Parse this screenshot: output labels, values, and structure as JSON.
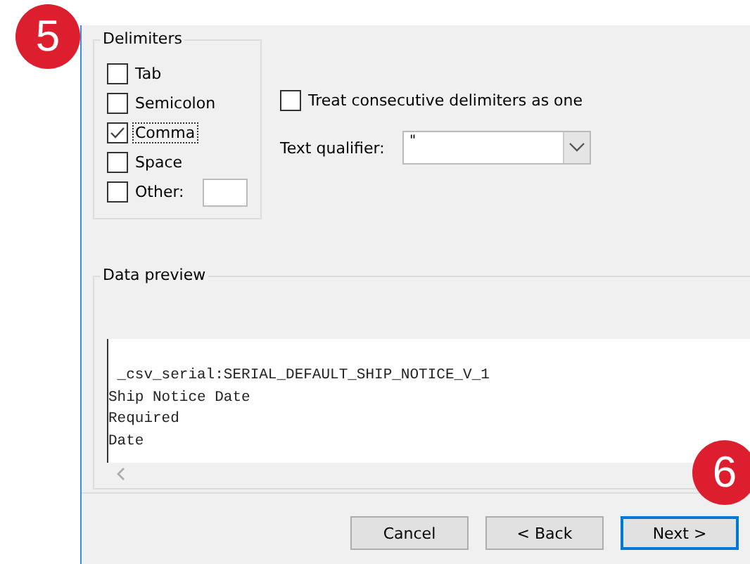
{
  "badges": [
    {
      "label": "5"
    },
    {
      "label": "6"
    }
  ],
  "delimiters": {
    "title": "Delimiters",
    "options": [
      {
        "label": "Tab",
        "checked": false,
        "focused": false
      },
      {
        "label": "Semicolon",
        "checked": false,
        "focused": false
      },
      {
        "label": "Comma",
        "checked": true,
        "focused": true
      },
      {
        "label": "Space",
        "checked": false,
        "focused": false
      },
      {
        "label": "Other:",
        "checked": false,
        "focused": false,
        "kind": "with_field"
      }
    ]
  },
  "consecutive": {
    "label": "Treat consecutive delimiters as one",
    "checked": false
  },
  "qualifier": {
    "label": "Text qualifier:",
    "value": "\""
  },
  "preview": {
    "title": "Data preview",
    "lines": [
      " _csv_serial:SERIAL_DEFAULT_SHIP_NOTICE_V_1",
      "Ship Notice Date",
      "Required",
      "Date"
    ]
  },
  "buttons": [
    {
      "label": "Cancel",
      "focused": false
    },
    {
      "label": "< Back",
      "focused": false
    },
    {
      "label": "Next >",
      "focused": true
    }
  ]
}
